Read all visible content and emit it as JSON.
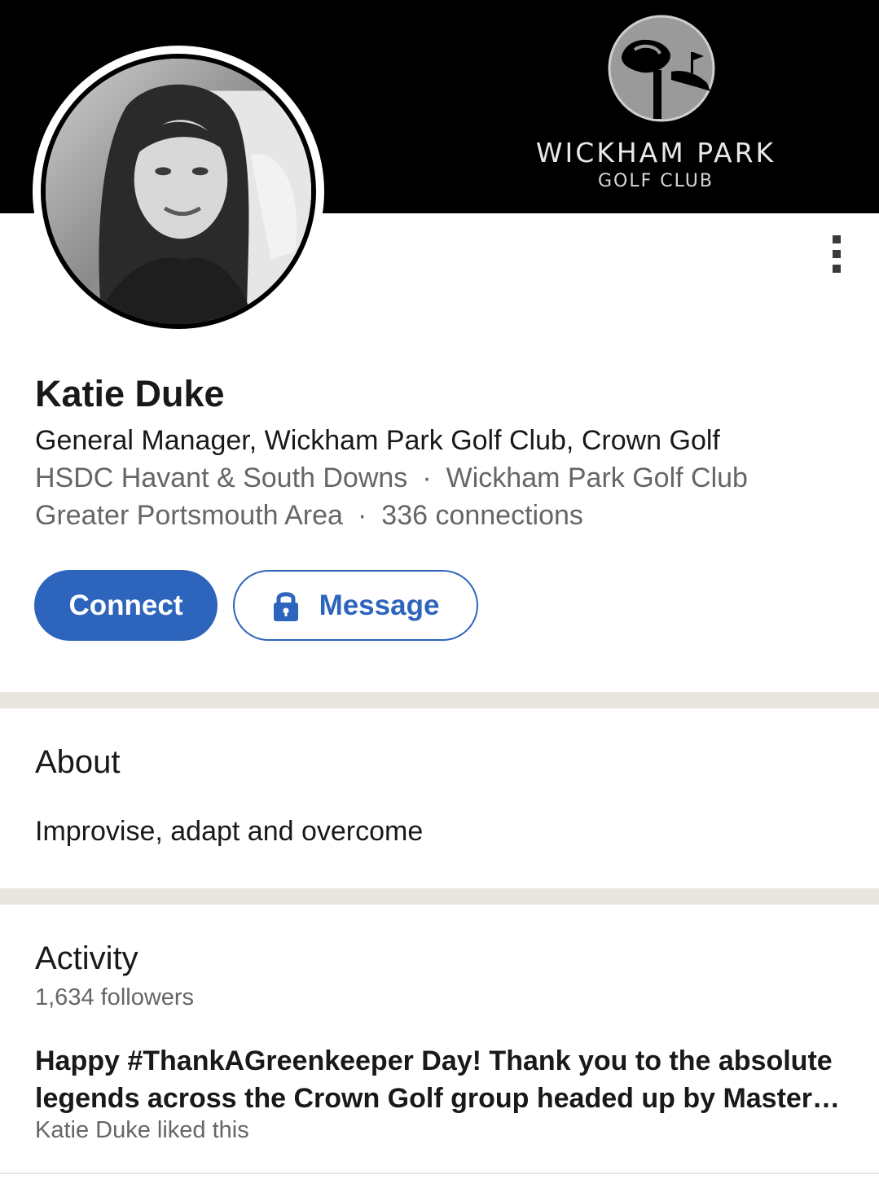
{
  "cover": {
    "logo_line1": "WICKHAM PARK",
    "logo_line2": "GOLF CLUB",
    "logo_icon": "golf-club-emblem"
  },
  "profile": {
    "name": "Katie Duke",
    "headline": "General Manager, Wickham Park Golf Club, Crown Golf",
    "education": "HSDC Havant & South Downs",
    "company": "Wickham Park Golf Club",
    "location": "Greater Portsmouth Area",
    "connections": "336 connections",
    "separator": "·"
  },
  "actions": {
    "connect_label": "Connect",
    "message_label": "Message",
    "more_icon": "more-vertical-icon",
    "lock_icon": "lock-icon"
  },
  "about": {
    "title": "About",
    "text": "Improvise, adapt and overcome"
  },
  "activity": {
    "title": "Activity",
    "followers": "1,634 followers",
    "post_line1": "Happy #ThankAGreenkeeper Day! Thank you to the absolute",
    "post_line2": "legends across the Crown Golf group headed up by Master…",
    "post_meta": "Katie Duke liked this"
  },
  "colors": {
    "accent": "#2d64bc",
    "divider": "#e9e5df",
    "secondary_text": "#666666"
  }
}
